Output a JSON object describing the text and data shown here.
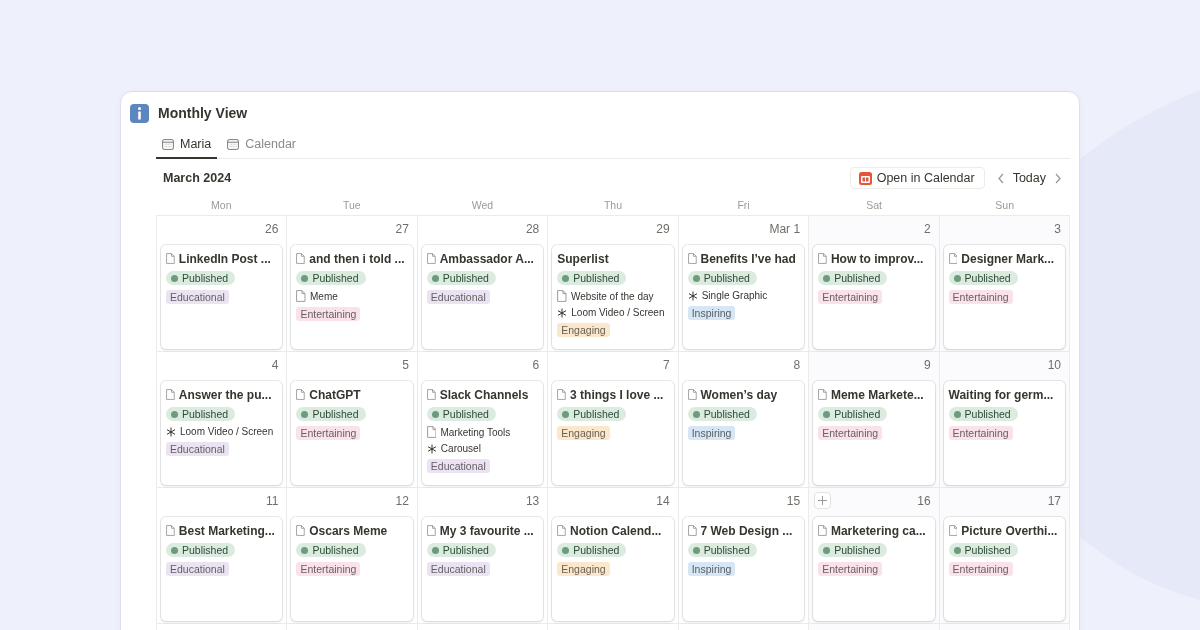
{
  "page": {
    "title": "Monthly View"
  },
  "tabs": [
    {
      "label": "Maria",
      "selected": true
    },
    {
      "label": "Calendar",
      "selected": false
    }
  ],
  "calendar": {
    "month": "March 2024",
    "open_button": "Open in Calendar",
    "today_button": "Today",
    "weekdays": [
      {
        "label": "Mon",
        "weekend": false
      },
      {
        "label": "Tue",
        "weekend": false
      },
      {
        "label": "Wed",
        "weekend": false
      },
      {
        "label": "Thu",
        "weekend": false
      },
      {
        "label": "Fri",
        "weekend": false
      },
      {
        "label": "Sat",
        "weekend": true
      },
      {
        "label": "Sun",
        "weekend": true
      }
    ],
    "weeks": [
      [
        {
          "date": "26",
          "cards": [
            {
              "title": "LinkedIn Post ...",
              "page_icon": true,
              "status": "Published",
              "tag": {
                "label": "Educational",
                "color": "#ebe3f1"
              }
            }
          ]
        },
        {
          "date": "27",
          "cards": [
            {
              "title": "and then i told ...",
              "page_icon": true,
              "status": "Published",
              "properties": [
                {
                  "kind": "doc",
                  "text": "Meme"
                }
              ],
              "tag": {
                "label": "Entertaining",
                "color": "#f9e2ea"
              }
            }
          ]
        },
        {
          "date": "28",
          "cards": [
            {
              "title": "Ambassador A...",
              "page_icon": true,
              "status": "Published",
              "tag": {
                "label": "Educational",
                "color": "#ebe3f1"
              }
            }
          ]
        },
        {
          "date": "29",
          "cards": [
            {
              "title": "Superlist",
              "page_icon": false,
              "status": "Published",
              "properties": [
                {
                  "kind": "doc",
                  "text": "Website of the day"
                },
                {
                  "kind": "asterisk",
                  "text": "Loom Video / Screen"
                }
              ],
              "tag": {
                "label": "Engaging",
                "color": "#fbe7cb"
              }
            }
          ]
        },
        {
          "date": "Mar 1",
          "cards": [
            {
              "title": "Benefits I’ve had",
              "page_icon": true,
              "status": "Published",
              "properties": [
                {
                  "kind": "asterisk",
                  "text": "Single Graphic"
                }
              ],
              "tag": {
                "label": "Inspiring",
                "color": "#d6e6f4"
              }
            }
          ]
        },
        {
          "date": "2",
          "cards": [
            {
              "title": "How to improv...",
              "page_icon": true,
              "status": "Published",
              "tag": {
                "label": "Entertaining",
                "color": "#f9e2ea"
              }
            }
          ]
        },
        {
          "date": "3",
          "cards": [
            {
              "title": "Designer Mark...",
              "page_icon": true,
              "status": "Published",
              "tag": {
                "label": "Entertaining",
                "color": "#f9e2ea"
              }
            }
          ]
        }
      ],
      [
        {
          "date": "4",
          "cards": [
            {
              "title": "Answer the pu...",
              "page_icon": true,
              "status": "Published",
              "properties": [
                {
                  "kind": "asterisk",
                  "text": "Loom Video / Screen"
                }
              ],
              "tag": {
                "label": "Educational",
                "color": "#ebe3f1"
              }
            }
          ]
        },
        {
          "date": "5",
          "cards": [
            {
              "title": "ChatGPT",
              "page_icon": true,
              "status": "Published",
              "tag": {
                "label": "Entertaining",
                "color": "#f9e2ea"
              }
            }
          ]
        },
        {
          "date": "6",
          "cards": [
            {
              "title": "Slack Channels",
              "page_icon": true,
              "status": "Published",
              "properties": [
                {
                  "kind": "doc",
                  "text": "Marketing Tools"
                },
                {
                  "kind": "asterisk",
                  "text": "Carousel"
                }
              ],
              "tag": {
                "label": "Educational",
                "color": "#ebe3f1"
              }
            }
          ]
        },
        {
          "date": "7",
          "cards": [
            {
              "title": "3 things I love ...",
              "page_icon": true,
              "status": "Published",
              "tag": {
                "label": "Engaging",
                "color": "#fbe7cb"
              }
            }
          ]
        },
        {
          "date": "8",
          "cards": [
            {
              "title": "Women’s day",
              "page_icon": true,
              "status": "Published",
              "tag": {
                "label": "Inspiring",
                "color": "#d6e6f4"
              }
            }
          ]
        },
        {
          "date": "9",
          "cards": [
            {
              "title": "Meme Markete...",
              "page_icon": true,
              "status": "Published",
              "tag": {
                "label": "Entertaining",
                "color": "#f9e2ea"
              }
            }
          ]
        },
        {
          "date": "10",
          "cards": [
            {
              "title": "Waiting for germ...",
              "page_icon": false,
              "status": "Published",
              "tag": {
                "label": "Entertaining",
                "color": "#f9e2ea"
              }
            }
          ]
        }
      ],
      [
        {
          "date": "11",
          "cards": [
            {
              "title": "Best Marketing...",
              "page_icon": true,
              "status": "Published",
              "tag": {
                "label": "Educational",
                "color": "#ebe3f1"
              }
            }
          ]
        },
        {
          "date": "12",
          "cards": [
            {
              "title": "Oscars Meme",
              "page_icon": true,
              "status": "Published",
              "tag": {
                "label": "Entertaining",
                "color": "#f9e2ea"
              }
            }
          ]
        },
        {
          "date": "13",
          "cards": [
            {
              "title": "My 3 favourite ...",
              "page_icon": true,
              "status": "Published",
              "tag": {
                "label": "Educational",
                "color": "#ebe3f1"
              }
            }
          ]
        },
        {
          "date": "14",
          "cards": [
            {
              "title": "Notion Calend...",
              "page_icon": true,
              "status": "Published",
              "tag": {
                "label": "Engaging",
                "color": "#fbe7cb"
              }
            }
          ]
        },
        {
          "date": "15",
          "cards": [
            {
              "title": "7 Web Design ...",
              "page_icon": true,
              "status": "Published",
              "tag": {
                "label": "Inspiring",
                "color": "#d6e6f4"
              }
            }
          ]
        },
        {
          "date": "16",
          "add_button": true,
          "cards": [
            {
              "title": "Marketering ca...",
              "page_icon": true,
              "status": "Published",
              "tag": {
                "label": "Entertaining",
                "color": "#f9e2ea"
              }
            }
          ]
        },
        {
          "date": "17",
          "cards": [
            {
              "title": "Picture Overthi...",
              "page_icon": true,
              "status": "Published",
              "tag": {
                "label": "Entertaining",
                "color": "#f9e2ea"
              }
            }
          ]
        }
      ]
    ]
  }
}
